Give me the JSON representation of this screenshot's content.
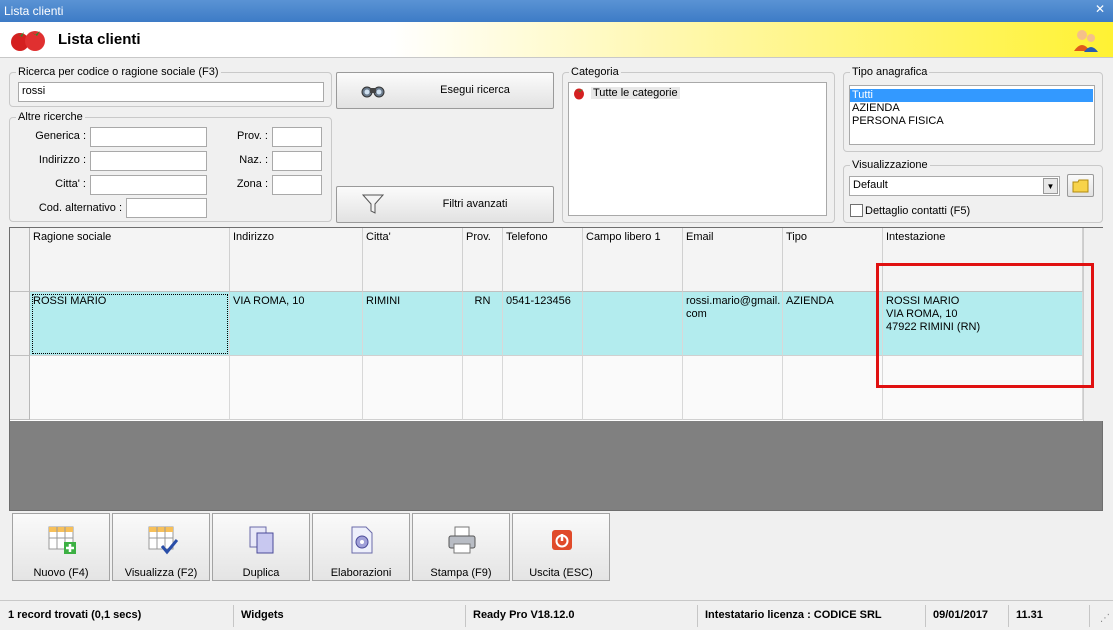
{
  "window": {
    "title": "Lista clienti"
  },
  "header": {
    "title": "Lista clienti"
  },
  "search": {
    "legend": "Ricerca per codice o ragione sociale (F3)",
    "value": "rossi",
    "run_label": "Esegui ricerca",
    "advanced_label": "Filtri avanzati"
  },
  "other_search": {
    "legend": "Altre ricerche",
    "generica": "Generica :",
    "indirizzo": "Indirizzo :",
    "citta": "Citta' :",
    "cod_alt": "Cod. alternativo :",
    "prov": "Prov. :",
    "naz": "Naz. :",
    "zona": "Zona :"
  },
  "categoria": {
    "legend": "Categoria",
    "item": "Tutte le categorie"
  },
  "tipo_anagrafica": {
    "legend": "Tipo anagrafica",
    "options": [
      "Tutti",
      "AZIENDA",
      "PERSONA FISICA"
    ]
  },
  "visualizzazione": {
    "legend": "Visualizzazione",
    "selected": "Default",
    "dettaglio": "Dettaglio contatti (F5)"
  },
  "table": {
    "columns": [
      "Ragione sociale",
      "Indirizzo",
      "Citta'",
      "Prov.",
      "Telefono",
      "Campo libero 1",
      "Email",
      "Tipo",
      "Intestazione"
    ],
    "rows": [
      {
        "ragione": "ROSSI MARIO",
        "indirizzo": "VIA ROMA, 10",
        "citta": "RIMINI",
        "prov": "RN",
        "telefono": "0541-123456",
        "campo": "",
        "email_1": "rossi.mario@gmail.",
        "email_2": "com",
        "tipo": "AZIENDA",
        "int_1": "ROSSI MARIO",
        "int_2": "VIA ROMA, 10",
        "int_3": "47922 RIMINI (RN)"
      }
    ]
  },
  "buttons": {
    "nuovo": "Nuovo (F4)",
    "visualizza": "Visualizza (F2)",
    "duplica": "Duplica",
    "elaborazioni": "Elaborazioni",
    "stampa": "Stampa (F9)",
    "uscita": "Uscita (ESC)"
  },
  "status": {
    "records": "1 record trovati (0,1 secs)",
    "widgets": "Widgets",
    "version": "Ready Pro V18.12.0",
    "license": "Intestatario licenza : CODICE SRL",
    "date": "09/01/2017",
    "time": "11.31"
  },
  "colors": {
    "selected_row": "#b3ecee",
    "highlight": "#e01010",
    "header_accent": "#fff233"
  }
}
